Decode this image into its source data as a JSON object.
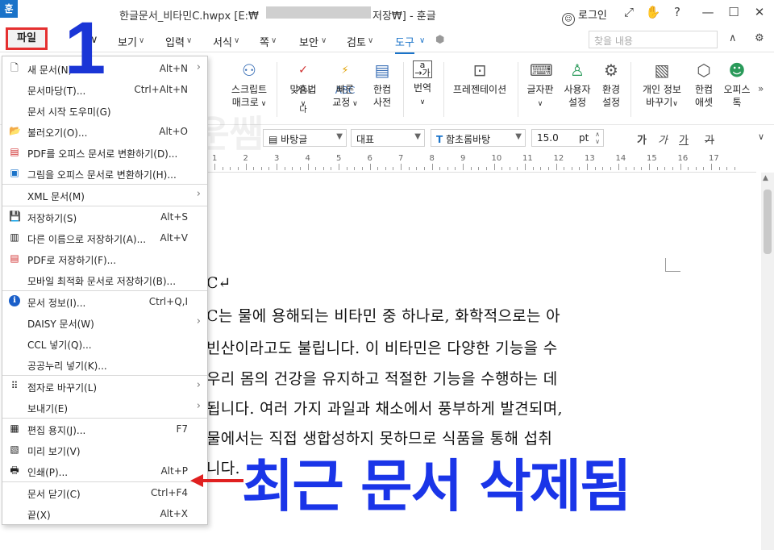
{
  "title_bar": {
    "app_logo": "훈",
    "title": "한글문서_비타민C.hwpx [E:₩",
    "title_tail": "저장₩] - 훈글",
    "login_label": "로그인",
    "controls": [
      "⤢",
      "✋",
      "?",
      "—",
      "☐",
      "✕"
    ]
  },
  "menu_tabs": {
    "file": "파일",
    "items": [
      "보기",
      "입력",
      "서식",
      "쪽",
      "보안",
      "검토",
      "도구"
    ],
    "active": "도구",
    "search_placeholder": "찾을 내용"
  },
  "ribbon": {
    "buttons": [
      {
        "label1": "스크립트",
        "label2": "매크로",
        "icon": "script-icon"
      },
      {
        "label1": "맞춤법",
        "label2": "",
        "icon": "spellcheck-icon",
        "icon_text": "가나다"
      },
      {
        "label1": "빠른",
        "label2": "교정",
        "icon": "quick-correct-icon",
        "icon_text": "ABC"
      },
      {
        "label1": "한컴",
        "label2": "사전",
        "icon": "dictionary-icon"
      },
      {
        "label1": "번역",
        "label2": "",
        "icon": "translate-icon"
      },
      {
        "label1": "프레젠테이션",
        "label2": "",
        "icon": "presentation-icon"
      },
      {
        "label1": "글자판",
        "label2": "",
        "icon": "keyboard-icon"
      },
      {
        "label1": "사용자",
        "label2": "설정",
        "icon": "user-settings-icon"
      },
      {
        "label1": "환경",
        "label2": "설정",
        "icon": "gear-icon"
      },
      {
        "label1": "개인 정보",
        "label2": "바꾸기",
        "icon": "privacy-icon"
      },
      {
        "label1": "한컴",
        "label2": "애셋",
        "icon": "asset-icon"
      },
      {
        "label1": "오피스",
        "label2": "톡",
        "icon": "office-talk-icon"
      }
    ]
  },
  "format_bar": {
    "style": "바탕글",
    "lang": "대표",
    "font": "함초롬바탕",
    "size": "15.0",
    "unit": "pt",
    "fmt_icons": [
      "가",
      "가",
      "가",
      "가"
    ]
  },
  "ruler": {
    "numbers": [
      "1",
      "2",
      "3",
      "4",
      "5",
      "6",
      "7",
      "8",
      "9",
      "10",
      "11",
      "12",
      "13",
      "14",
      "15",
      "16",
      "17"
    ]
  },
  "document": {
    "title": "C↵",
    "lines": [
      "C는 물에 용해되는 비타민 중 하나로, 화학적으로는 아",
      "빈산이라고도 불립니다. 이 비타민은 다양한 기능을 수",
      "우리 몸의 건강을 유지하고 적절한 기능을 수행하는 데",
      "됩니다. 여러 가지 과일과 채소에서 풍부하게 발견되며,",
      "물에서는 직접 생합성하지 못하므로 식품을 통해 섭취",
      "니다."
    ]
  },
  "file_menu": {
    "items": [
      {
        "icon": "new-doc-icon",
        "glyph": "🗋",
        "label": "새 문서(N)",
        "shortcut": "Alt+N",
        "submenu": true
      },
      {
        "icon": "",
        "glyph": "",
        "label": "문서마당(T)...",
        "shortcut": "Ctrl+Alt+N",
        "submenu": false
      },
      {
        "icon": "",
        "glyph": "",
        "label": "문서 시작 도우미(G)",
        "shortcut": "",
        "submenu": false
      },
      {
        "icon": "folder-open-icon",
        "glyph": "📂",
        "label": "불러오기(O)...",
        "shortcut": "Alt+O",
        "submenu": false
      },
      {
        "icon": "pdf-convert-icon",
        "glyph": "▤",
        "label": "PDF를 오피스 문서로 변환하기(D)...",
        "shortcut": "",
        "submenu": false
      },
      {
        "icon": "image-convert-icon",
        "glyph": "▣",
        "label": "그림을 오피스 문서로 변환하기(H)...",
        "shortcut": "",
        "submenu": false
      },
      {
        "icon": "",
        "glyph": "",
        "label": "XML 문서(M)",
        "shortcut": "",
        "submenu": true
      },
      {
        "icon": "save-icon",
        "glyph": "💾",
        "label": "저장하기(S)",
        "shortcut": "Alt+S",
        "submenu": false
      },
      {
        "icon": "save-as-icon",
        "glyph": "▥",
        "label": "다른 이름으로 저장하기(A)...",
        "shortcut": "Alt+V",
        "submenu": false
      },
      {
        "icon": "save-pdf-icon",
        "glyph": "▤",
        "label": "PDF로 저장하기(F)...",
        "shortcut": "",
        "submenu": false
      },
      {
        "icon": "",
        "glyph": "",
        "label": "모바일 최적화 문서로 저장하기(B)...",
        "shortcut": "",
        "submenu": false
      },
      {
        "icon": "info-icon",
        "glyph": "ℹ",
        "label": "문서 정보(I)...",
        "shortcut": "Ctrl+Q,I",
        "submenu": false
      },
      {
        "icon": "",
        "glyph": "",
        "label": "DAISY 문서(W)",
        "shortcut": "",
        "submenu": true
      },
      {
        "icon": "",
        "glyph": "",
        "label": "CCL 넣기(Q)...",
        "shortcut": "",
        "submenu": false
      },
      {
        "icon": "",
        "glyph": "",
        "label": "공공누리 넣기(K)...",
        "shortcut": "",
        "submenu": false
      },
      {
        "icon": "braille-icon",
        "glyph": "⠿",
        "label": "점자로 바꾸기(L)",
        "shortcut": "",
        "submenu": true
      },
      {
        "icon": "",
        "glyph": "",
        "label": "보내기(E)",
        "shortcut": "",
        "submenu": true
      },
      {
        "icon": "page-setup-icon",
        "glyph": "▦",
        "label": "편집 용지(J)...",
        "shortcut": "F7",
        "submenu": false
      },
      {
        "icon": "preview-icon",
        "glyph": "▧",
        "label": "미리 보기(V)",
        "shortcut": "",
        "submenu": false
      },
      {
        "icon": "print-icon",
        "glyph": "🖶",
        "label": "인쇄(P)...",
        "shortcut": "Alt+P",
        "submenu": false
      },
      {
        "icon": "",
        "glyph": "",
        "label": "문서 닫기(C)",
        "shortcut": "Ctrl+F4",
        "submenu": false
      },
      {
        "icon": "",
        "glyph": "",
        "label": "끝(X)",
        "shortcut": "Alt+X",
        "submenu": false
      }
    ]
  },
  "annotations": {
    "step_number": "1",
    "caption": "최근 문서 삭제됨",
    "watermark": "쉬운쌤",
    "accent_red": "#e02020",
    "accent_blue": "#1a35e8"
  }
}
